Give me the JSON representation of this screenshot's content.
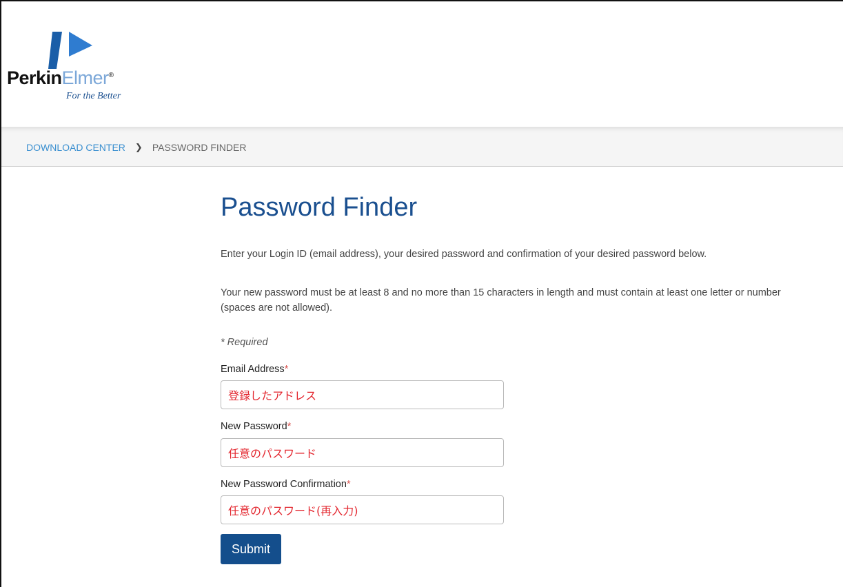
{
  "brand": {
    "name_part1": "Perkin",
    "name_part2": "Elmer",
    "registered_mark": "®",
    "tagline": "For the Better",
    "primary_color": "#1a4f8f",
    "accent_color": "#7ba7d8"
  },
  "breadcrumb": {
    "items": [
      "DOWNLOAD CENTER",
      "PASSWORD FINDER"
    ],
    "separator": "›"
  },
  "page": {
    "title": "Password Finder",
    "intro": "Enter your Login ID (email address), your desired password and confirmation of your desired password below.",
    "rules": "Your new password must be at least 8 and no more than 15 characters in length and must contain at least one letter or number (spaces are not allowed).",
    "required_note": "* Required"
  },
  "form": {
    "required_marker": "*",
    "email": {
      "label": "Email Address",
      "value": "登録したアドレス"
    },
    "password": {
      "label": "New Password",
      "value": "任意のパスワード"
    },
    "password_confirmation": {
      "label": "New Password Confirmation",
      "value": "任意のパスワード(再入力)"
    },
    "submit_label": "Submit",
    "input_text_color": "#e3262e",
    "button_color": "#144e8c"
  }
}
